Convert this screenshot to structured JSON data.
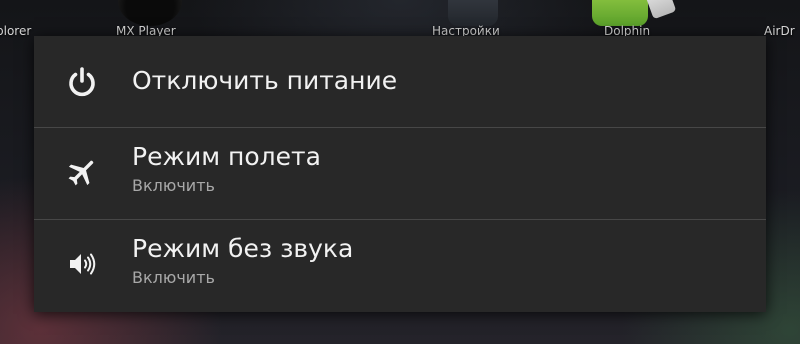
{
  "home_screen": {
    "labels": [
      "plorer",
      "MX Player",
      "Настройки",
      "Dolphin",
      "AirDr"
    ]
  },
  "power_menu": {
    "items": [
      {
        "title": "Отключить питание",
        "icon": "power-icon"
      },
      {
        "title": "Режим полета",
        "subtitle": "Включить",
        "icon": "airplane-icon"
      },
      {
        "title": "Режим без звука",
        "subtitle": "Включить",
        "icon": "volume-icon"
      }
    ]
  },
  "colors": {
    "dialog_bg": "#282828",
    "divider": "#474747",
    "title_text": "#f2f2f2",
    "subtitle_text": "#a8a8a8"
  }
}
